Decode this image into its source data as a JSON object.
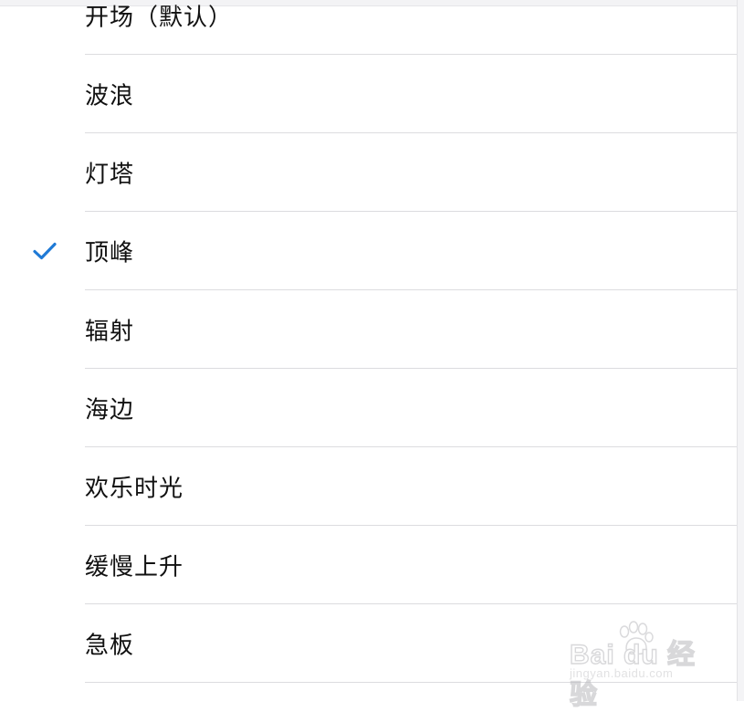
{
  "list": {
    "items": [
      {
        "label": "开场（默认）",
        "selected": false
      },
      {
        "label": "波浪",
        "selected": false
      },
      {
        "label": "灯塔",
        "selected": false
      },
      {
        "label": "顶峰",
        "selected": true
      },
      {
        "label": "辐射",
        "selected": false
      },
      {
        "label": "海边",
        "selected": false
      },
      {
        "label": "欢乐时光",
        "selected": false
      },
      {
        "label": "缓慢上升",
        "selected": false
      },
      {
        "label": "急板",
        "selected": false
      }
    ]
  },
  "colors": {
    "accent": "#1f7ad6",
    "separator": "#dcdcdf",
    "text": "#111111"
  },
  "icons": {
    "selected_marker": "checkmark-icon"
  },
  "watermark": {
    "brand": "Bai du 经验",
    "domain": "jingyan.baidu.com"
  }
}
